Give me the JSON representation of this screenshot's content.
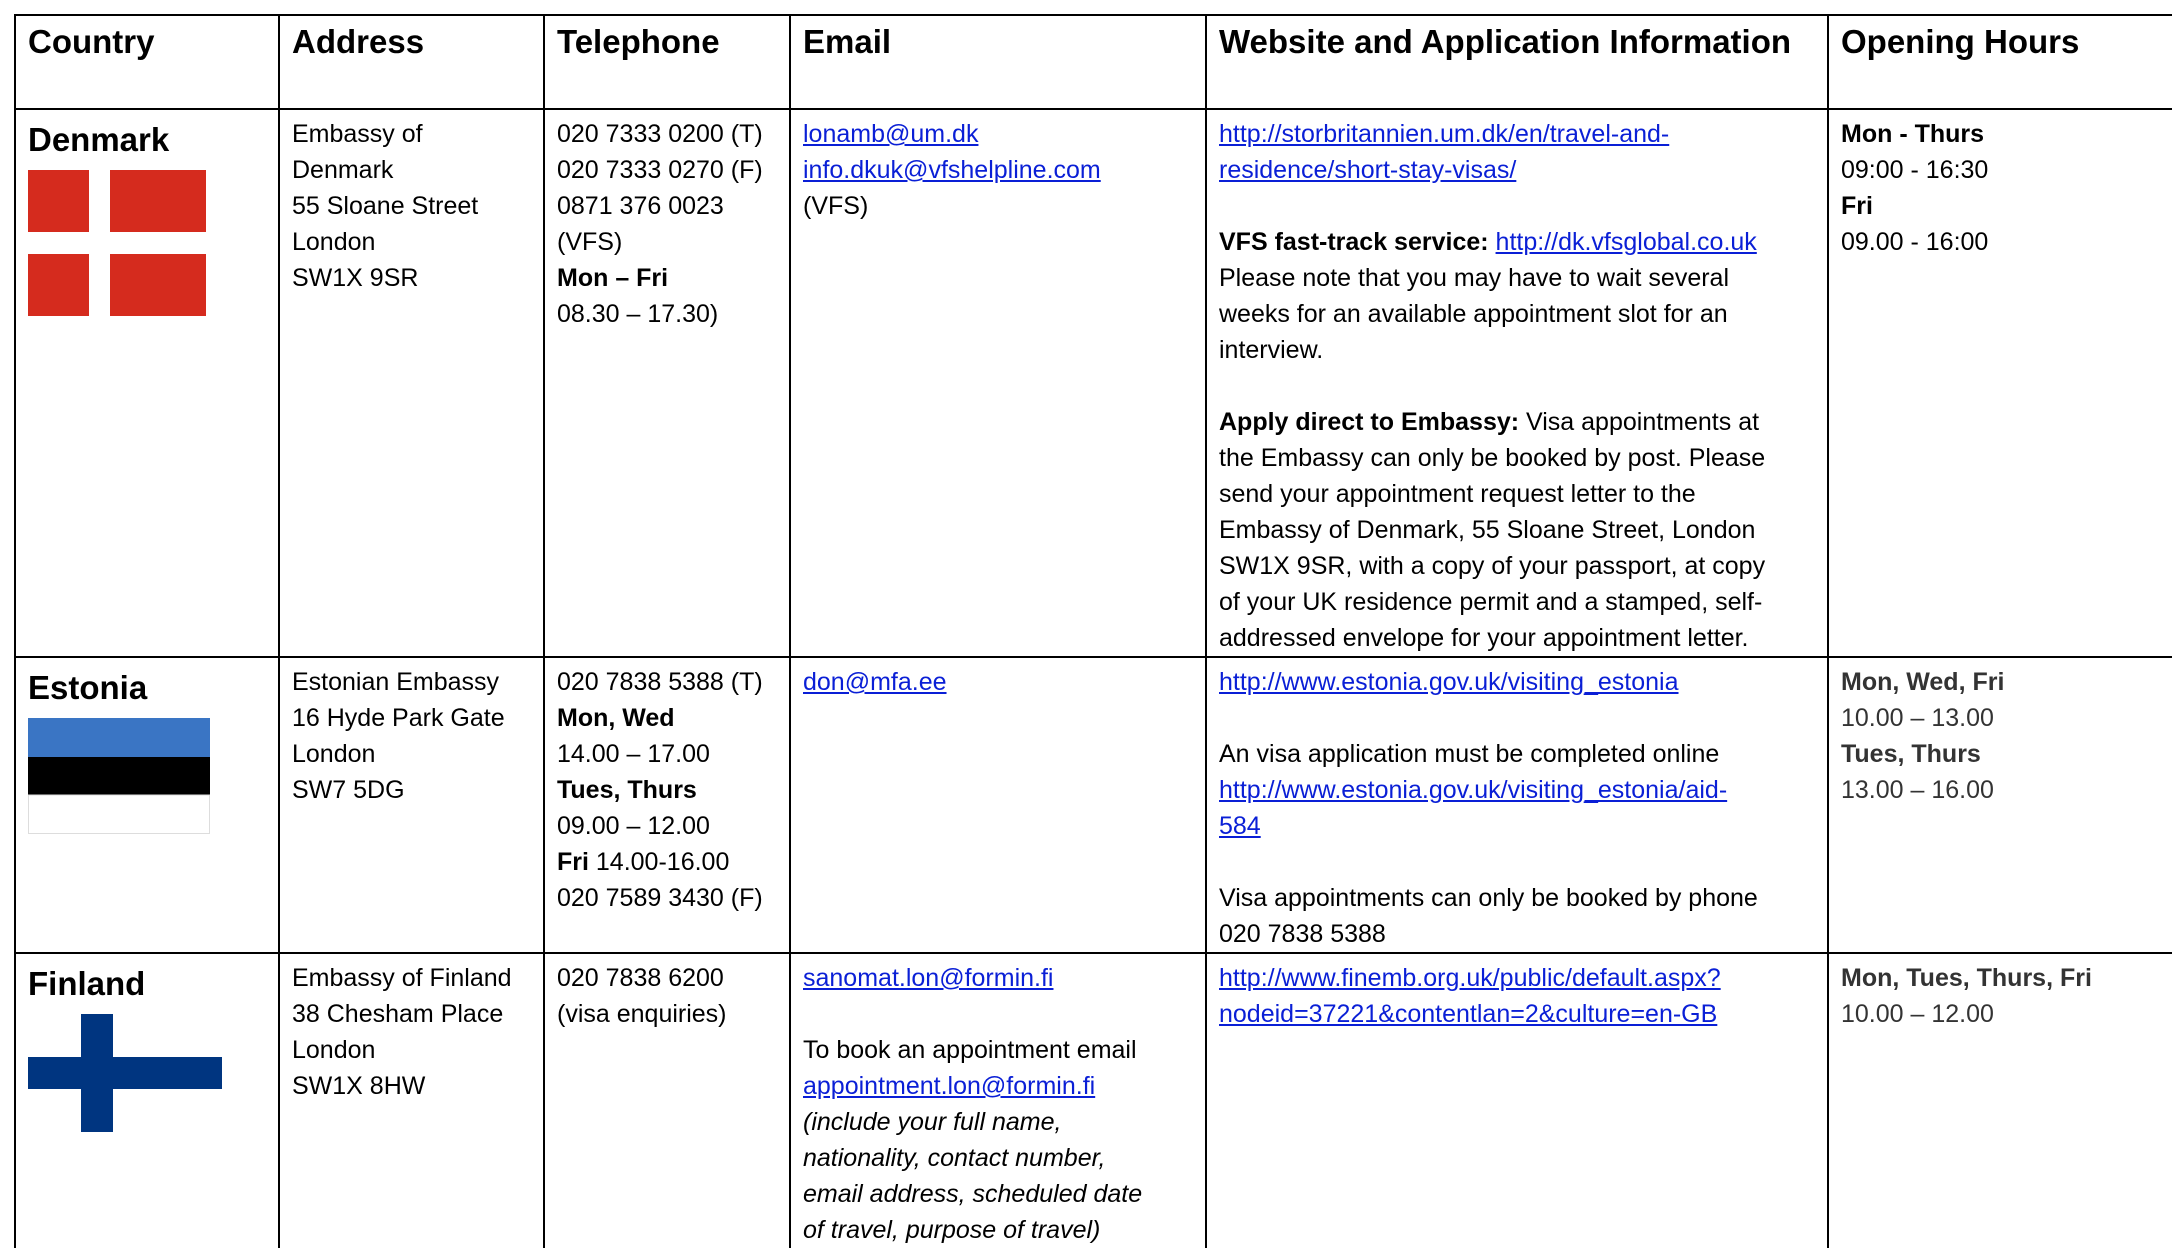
{
  "headers": {
    "country": "Country",
    "address": "Address",
    "telephone": "Telephone",
    "email": "Email",
    "website": "Website and Application Information",
    "hours": "Opening Hours"
  },
  "denmark": {
    "name": "Denmark",
    "flag_colors": {
      "red": "#d52b1e",
      "white": "#ffffff"
    },
    "address": [
      "Embassy of",
      "Denmark",
      "55 Sloane Street",
      "London",
      "SW1X 9SR"
    ],
    "tel": [
      "020 7333 0200 (T)",
      "020 7333 0270 (F)",
      "0871 376 0023",
      "(VFS)"
    ],
    "tel_days": "Mon – Fri",
    "tel_hours": "08.30 – 17.30)",
    "email_1": "lonamb@um.dk",
    "email_2": "info.dkuk@vfshelpline.com",
    "email_note": "(VFS)",
    "web_link_1a": "http://storbritannien.um.dk/en/travel-and-",
    "web_link_1b": "residence/short-stay-visas/",
    "vfs_label": "VFS fast-track service:",
    "vfs_link": "http://dk.vfsglobal.co.uk",
    "vfs_note": [
      "Please note that you may have to wait several",
      "weeks for an available appointment slot for an",
      "interview."
    ],
    "direct_label": "Apply direct to Embassy:",
    "direct_text_first": "Visa appointments at",
    "direct_text": [
      "the Embassy can only be booked by post. Please",
      "send your appointment request letter to the",
      "Embassy of Denmark, 55 Sloane Street, London",
      "SW1X 9SR, with a copy of your passport, at copy",
      "of your UK residence permit and a stamped, self-",
      "addressed envelope for your appointment letter."
    ],
    "hours_days_1": "Mon - Thurs",
    "hours_time_1": "09:00 - 16:30",
    "hours_days_2": "Fri",
    "hours_time_2": "09.00 - 16:00"
  },
  "estonia": {
    "name": "Estonia",
    "flag_colors": {
      "blue": "#3a75c4",
      "black": "#000000",
      "white": "#ffffff"
    },
    "address": [
      "Estonian Embassy",
      "16 Hyde Park Gate",
      "London",
      "SW7 5DG"
    ],
    "tel_1": "020 7838 5388 (T)",
    "tel_days_1": "Mon, Wed",
    "tel_time_1": "14.00 – 17.00",
    "tel_days_2": "Tues, Thurs",
    "tel_time_2": "09.00 – 12.00",
    "tel_days_3": "Fri",
    "tel_time_3": " 14.00-16.00",
    "tel_fax": "020 7589 3430 (F)",
    "email": "don@mfa.ee",
    "web_link": "http://www.estonia.gov.uk/visiting_estonia",
    "web_note": "An visa application must be completed online",
    "web_link_2a": "http://www.estonia.gov.uk/visiting_estonia/aid-",
    "web_link_2b": "584",
    "phone_note_1": "Visa appointments can only be booked by phone",
    "phone_note_2": "020 7838 5388",
    "hours_days_1": "Mon, Wed, Fri",
    "hours_time_1": "10.00 – 13.00",
    "hours_days_2": "Tues, Thurs",
    "hours_time_2": "13.00 – 16.00"
  },
  "finland": {
    "name": "Finland",
    "flag_colors": {
      "blue": "#003580",
      "white": "#ffffff"
    },
    "address": [
      "Embassy of Finland",
      "38 Chesham Place",
      "London",
      "SW1X 8HW"
    ],
    "tel": [
      "020 7838 6200",
      "(visa enquiries)"
    ],
    "email": "sanomat.lon@formin.fi",
    "booking_note": "To book an appointment email",
    "booking_email": "appointment.lon@formin.fi",
    "booking_detail": [
      "(include your full name,",
      "nationality, contact number,",
      "email address, scheduled date",
      "of travel, purpose of travel)"
    ],
    "web_link_a": "http://www.finemb.org.uk/public/default.aspx?",
    "web_link_b": "nodeid=37221&contentlan=2&culture=en-GB",
    "hours_days": "Mon, Tues, Thurs, Fri",
    "hours_time": "10.00 – 12.00"
  }
}
